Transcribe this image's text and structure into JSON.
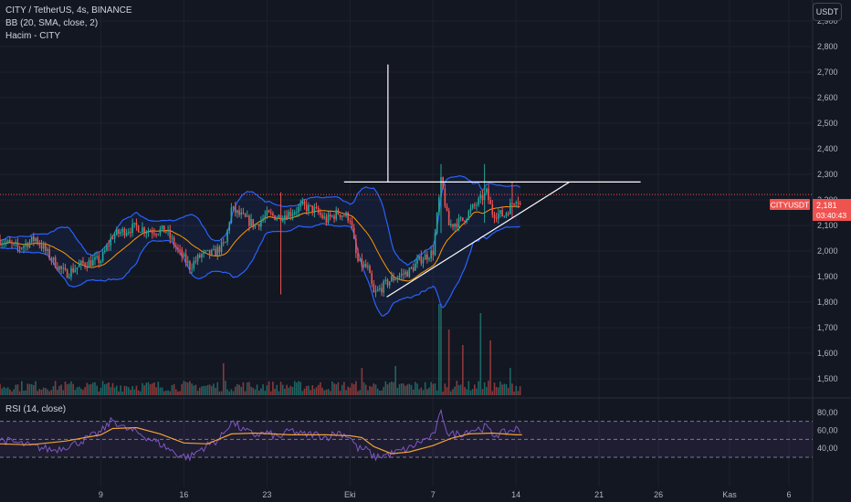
{
  "legend": {
    "symbol": "CITY / TetherUS, 4s, BINANCE",
    "bb": "BB (20, SMA, close, 2)",
    "volume": "Hacim - CITY",
    "rsi": "RSI (14, close)"
  },
  "currency_button": "USDT",
  "price_tag": {
    "symbol": "CITYUSDT",
    "price": "2,181",
    "countdown": "03:40:43"
  },
  "colors": {
    "background": "#131722",
    "up": "#26a69a",
    "down": "#ef5350",
    "bb_band": "#2962ff",
    "bb_basis": "#ff9800",
    "rsi_line": "#7e57c2",
    "rsi_ma": "#f2a13a",
    "drawing": "#ffffff",
    "grid": "#1e222d"
  },
  "chart_data": [
    {
      "type": "candlestick",
      "y_ticks": [
        "1,500",
        "1,600",
        "1,700",
        "1,800",
        "1,900",
        "2,000",
        "2,100",
        "2,200",
        "2,300",
        "2,400",
        "2,500",
        "2,600",
        "2,700",
        "2,800",
        "2,900"
      ],
      "ylim": [
        1450,
        2900
      ],
      "x_ticks": [
        {
          "label": "9",
          "day": 9
        },
        {
          "label": "16",
          "day": 16
        },
        {
          "label": "23",
          "day": 23
        },
        {
          "label": "Eki",
          "day": 30
        },
        {
          "label": "7",
          "day": 37
        },
        {
          "label": "14",
          "day": 44
        },
        {
          "label": "21",
          "day": 51
        },
        {
          "label": "26",
          "day": 56
        },
        {
          "label": "Kas",
          "day": 62
        },
        {
          "label": "6",
          "day": 67
        }
      ],
      "xlim": [
        0.5,
        69
      ],
      "last_price": 2181,
      "close_path": [
        [
          0.5,
          2045
        ],
        [
          2,
          2010
        ],
        [
          3.5,
          2050
        ],
        [
          5,
          1960
        ],
        [
          6,
          1910
        ],
        [
          7.5,
          1950
        ],
        [
          9,
          1965
        ],
        [
          10,
          2060
        ],
        [
          11,
          2080
        ],
        [
          12,
          2095
        ],
        [
          13,
          2080
        ],
        [
          14.5,
          2080
        ],
        [
          15.5,
          2000
        ],
        [
          16.5,
          1940
        ],
        [
          17.5,
          1985
        ],
        [
          18.5,
          1990
        ],
        [
          19.5,
          2030
        ],
        [
          20,
          2165
        ],
        [
          21,
          2130
        ],
        [
          22,
          2100
        ],
        [
          23,
          2140
        ],
        [
          24,
          2135
        ],
        [
          25,
          2150
        ],
        [
          26,
          2175
        ],
        [
          27,
          2160
        ],
        [
          28,
          2120
        ],
        [
          29,
          2150
        ],
        [
          30,
          2130
        ],
        [
          30.6,
          1960
        ],
        [
          31.5,
          1930
        ],
        [
          32,
          1830
        ],
        [
          33.5,
          1890
        ],
        [
          35,
          1920
        ],
        [
          36,
          1970
        ],
        [
          37,
          1995
        ],
        [
          37.7,
          2280
        ],
        [
          38.3,
          2100
        ],
        [
          39.5,
          2120
        ],
        [
          40,
          2150
        ],
        [
          41,
          2200
        ],
        [
          41.5,
          2230
        ],
        [
          42,
          2150
        ],
        [
          43,
          2140
        ],
        [
          44,
          2210
        ],
        [
          44.5,
          2181
        ]
      ],
      "spikes": [
        {
          "day": 24.2,
          "high": 2230,
          "low": 1830
        },
        {
          "day": 37.7,
          "high": 2340,
          "low": 2070
        },
        {
          "day": 41.3,
          "high": 2340,
          "low": 2110
        },
        {
          "day": 43.7,
          "high": 2270,
          "low": 2130
        }
      ],
      "drawings": {
        "resistance": {
          "from": [
            29.5,
            2270
          ],
          "to": [
            54.5,
            2270
          ]
        },
        "vertical": {
          "day": 33.2,
          "from": 2730,
          "to": 2270
        },
        "trend": {
          "from": [
            33.1,
            1820
          ],
          "to": [
            48.5,
            2270
          ]
        }
      }
    },
    {
      "type": "bar",
      "name": "Hacim - CITY",
      "spikes": [
        {
          "day": 19.3,
          "v": 0.35
        },
        {
          "day": 31,
          "v": 0.3
        },
        {
          "day": 33.8,
          "v": 0.32
        },
        {
          "day": 37.6,
          "v": 1.0
        },
        {
          "day": 38.3,
          "v": 0.72
        },
        {
          "day": 39.5,
          "v": 0.55
        },
        {
          "day": 41,
          "v": 0.9
        },
        {
          "day": 41.8,
          "v": 0.6
        },
        {
          "day": 43.5,
          "v": 0.3
        }
      ]
    },
    {
      "type": "line",
      "name": "RSI (14, close)",
      "y_ticks": [
        "40,00",
        "60,00",
        "80,00"
      ],
      "ylim": [
        25,
        82
      ],
      "bands": [
        30,
        50,
        70
      ],
      "rsi_path": [
        [
          0.5,
          50
        ],
        [
          3,
          43
        ],
        [
          5,
          38
        ],
        [
          7,
          46
        ],
        [
          9,
          58
        ],
        [
          10,
          72
        ],
        [
          11,
          62
        ],
        [
          12,
          58
        ],
        [
          14,
          45
        ],
        [
          15.5,
          33
        ],
        [
          16.5,
          30
        ],
        [
          17.5,
          40
        ],
        [
          19,
          50
        ],
        [
          20,
          70
        ],
        [
          21,
          60
        ],
        [
          22,
          55
        ],
        [
          23,
          57
        ],
        [
          24,
          52
        ],
        [
          25,
          60
        ],
        [
          26,
          55
        ],
        [
          27,
          56
        ],
        [
          28,
          52
        ],
        [
          29,
          58
        ],
        [
          30,
          53
        ],
        [
          30.6,
          40
        ],
        [
          31.5,
          38
        ],
        [
          32,
          30
        ],
        [
          33.5,
          34
        ],
        [
          35,
          40
        ],
        [
          36,
          48
        ],
        [
          37,
          53
        ],
        [
          37.7,
          80
        ],
        [
          38.3,
          55
        ],
        [
          39.5,
          57
        ],
        [
          40,
          60
        ],
        [
          41,
          62
        ],
        [
          41.5,
          64
        ],
        [
          42,
          55
        ],
        [
          43,
          57
        ],
        [
          44,
          62
        ],
        [
          44.5,
          56
        ]
      ],
      "ma_path": [
        [
          0.5,
          45
        ],
        [
          3,
          44
        ],
        [
          6,
          48
        ],
        [
          9,
          55
        ],
        [
          10,
          62
        ],
        [
          12,
          63
        ],
        [
          14,
          56
        ],
        [
          16,
          46
        ],
        [
          18,
          45
        ],
        [
          20,
          56
        ],
        [
          22,
          57
        ],
        [
          25,
          55
        ],
        [
          28,
          55
        ],
        [
          30,
          54
        ],
        [
          31,
          52
        ],
        [
          32,
          42
        ],
        [
          33.5,
          34
        ],
        [
          35,
          36
        ],
        [
          37,
          43
        ],
        [
          38.5,
          51
        ],
        [
          40,
          56
        ],
        [
          42,
          57
        ],
        [
          44,
          55
        ],
        [
          44.5,
          55
        ]
      ]
    }
  ]
}
